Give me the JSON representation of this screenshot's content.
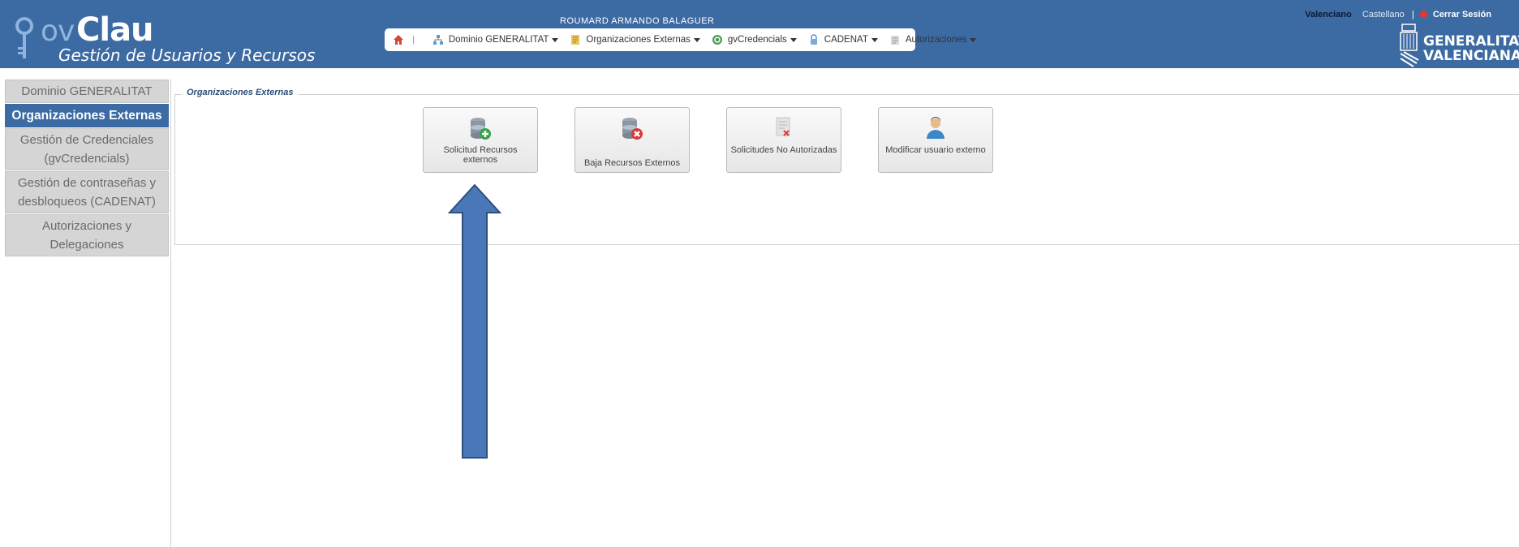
{
  "header": {
    "logo_ov": "ov",
    "logo_clau": "Clau",
    "logo_subtitle": "Gestión de Usuarios y Recursos",
    "user_name": "ROUMARD ARMANDO BALAGUER",
    "nav": [
      {
        "label": "Dominio GENERALITAT",
        "icon": "network-icon"
      },
      {
        "label": "Organizaciones Externas",
        "icon": "document-icon"
      },
      {
        "label": "gvCredencials",
        "icon": "refresh-icon"
      },
      {
        "label": "CADENAT",
        "icon": "lock-icon"
      },
      {
        "label": "Autorizaciones",
        "icon": "clipboard-icon"
      }
    ],
    "lang_valenciano": "Valenciano",
    "lang_castellano": "Castellano",
    "lang_sep": "|",
    "logout": "Cerrar Sesión",
    "gva_line1": "GENERALITAT",
    "gva_line2": "VALENCIANA"
  },
  "sidebar": {
    "items": [
      {
        "label": "Dominio GENERALITAT",
        "active": false
      },
      {
        "label": "Organizaciones Externas",
        "active": true
      },
      {
        "label": "Gestión de Credenciales (gvCredencials)",
        "active": false
      },
      {
        "label": "Gestión de contraseñas y desbloqueos (CADENAT)",
        "active": false
      },
      {
        "label": "Autorizaciones y Delegaciones",
        "active": false
      }
    ]
  },
  "main": {
    "legend": "Organizaciones Externas",
    "cards": [
      {
        "label": "Solicitud Recursos externos",
        "icon": "database-add-icon"
      },
      {
        "label": "Baja Recursos Externos",
        "icon": "database-remove-icon"
      },
      {
        "label": "Solicitudes No Autorizadas",
        "icon": "document-rejected-icon"
      },
      {
        "label": "Modificar usuario externo",
        "icon": "user-icon"
      }
    ]
  },
  "colors": {
    "header_bg": "#3c6aa3",
    "active_item": "#3c6aa3",
    "arrow": "#4a77b8"
  }
}
